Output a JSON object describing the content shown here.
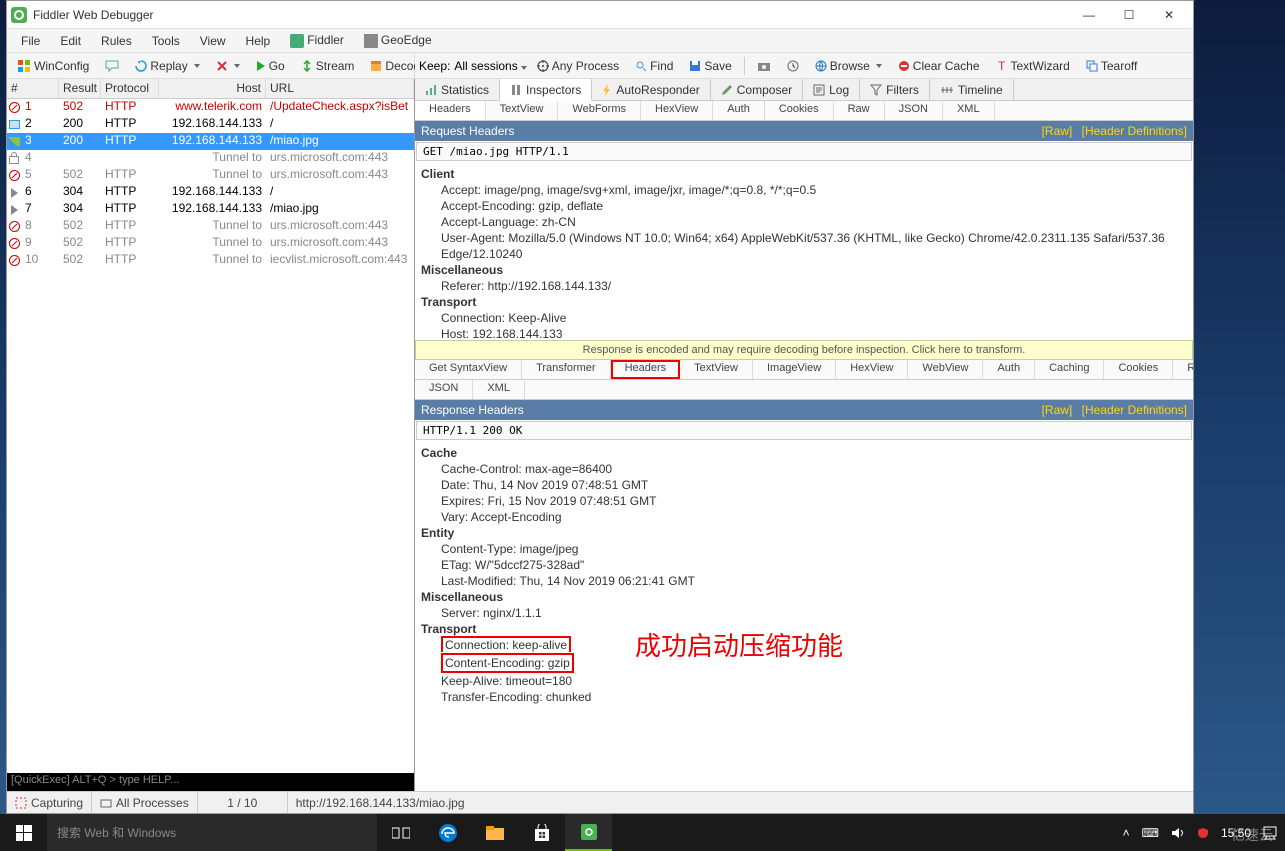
{
  "window_title": "Fiddler Web Debugger",
  "menus": [
    "File",
    "Edit",
    "Rules",
    "Tools",
    "View",
    "Help"
  ],
  "menu_extras": [
    {
      "label": "Fiddler",
      "icon": "fiddler"
    },
    {
      "label": "GeoEdge",
      "icon": "geo"
    }
  ],
  "toolbar": {
    "winconfig": "WinConfig",
    "replay": "Replay",
    "go": "Go",
    "stream": "Stream",
    "decode": "Decode"
  },
  "right_toolbar": {
    "keep_label": "Keep:",
    "keep_value": "All sessions",
    "any_process": "Any Process",
    "find": "Find",
    "save": "Save",
    "browse": "Browse",
    "clear_cache": "Clear Cache",
    "textwizard": "TextWizard",
    "tearoff": "Tearoff"
  },
  "session_cols": {
    "num": "#",
    "result": "Result",
    "protocol": "Protocol",
    "host": "Host",
    "url": "URL"
  },
  "sessions": [
    {
      "icon": "block",
      "num": "1",
      "result": "502",
      "proto": "HTTP",
      "host": "www.telerik.com",
      "url": "/UpdateCheck.aspx?isBet",
      "red": true
    },
    {
      "icon": "code",
      "num": "2",
      "result": "200",
      "proto": "HTTP",
      "host": "192.168.144.133",
      "url": "/"
    },
    {
      "icon": "img",
      "num": "3",
      "result": "200",
      "proto": "HTTP",
      "host": "192.168.144.133",
      "url": "/miao.jpg",
      "selected": true
    },
    {
      "icon": "lock",
      "num": "4",
      "result": "",
      "proto": "",
      "host": "Tunnel to",
      "url": "urs.microsoft.com:443",
      "gray": true
    },
    {
      "icon": "block",
      "num": "5",
      "result": "502",
      "proto": "HTTP",
      "host": "Tunnel to",
      "url": "urs.microsoft.com:443",
      "gray": true
    },
    {
      "icon": "arrow",
      "num": "6",
      "result": "304",
      "proto": "HTTP",
      "host": "192.168.144.133",
      "url": "/"
    },
    {
      "icon": "arrow",
      "num": "7",
      "result": "304",
      "proto": "HTTP",
      "host": "192.168.144.133",
      "url": "/miao.jpg"
    },
    {
      "icon": "block",
      "num": "8",
      "result": "502",
      "proto": "HTTP",
      "host": "Tunnel to",
      "url": "urs.microsoft.com:443",
      "gray": true
    },
    {
      "icon": "block",
      "num": "9",
      "result": "502",
      "proto": "HTTP",
      "host": "Tunnel to",
      "url": "urs.microsoft.com:443",
      "gray": true
    },
    {
      "icon": "block",
      "num": "10",
      "result": "502",
      "proto": "HTTP",
      "host": "Tunnel to",
      "url": "iecvlist.microsoft.com:443",
      "gray": true
    }
  ],
  "quickexec": "[QuickExec] ALT+Q > type HELP...",
  "main_tabs": [
    {
      "label": "Statistics",
      "icon": "chart"
    },
    {
      "label": "Inspectors",
      "icon": "inspect",
      "active": true
    },
    {
      "label": "AutoResponder",
      "icon": "bolt"
    },
    {
      "label": "Composer",
      "icon": "compose"
    },
    {
      "label": "Log",
      "icon": "log"
    },
    {
      "label": "Filters",
      "icon": "filter"
    },
    {
      "label": "Timeline",
      "icon": "timeline"
    }
  ],
  "req_tabs": [
    "Headers",
    "TextView",
    "WebForms",
    "HexView",
    "Auth",
    "Cookies",
    "Raw",
    "JSON",
    "XML"
  ],
  "req_section": {
    "title": "Request Headers",
    "raw": "[Raw]",
    "defs": "[Header Definitions]"
  },
  "req_line": "GET /miao.jpg HTTP/1.1",
  "req_headers": {
    "Client": [
      "Accept: image/png, image/svg+xml, image/jxr, image/*;q=0.8, */*;q=0.5",
      "Accept-Encoding: gzip, deflate",
      "Accept-Language: zh-CN",
      "User-Agent: Mozilla/5.0 (Windows NT 10.0; Win64; x64) AppleWebKit/537.36 (KHTML, like Gecko) Chrome/42.0.2311.135 Safari/537.36 Edge/12.10240"
    ],
    "Miscellaneous": [
      "Referer: http://192.168.144.133/"
    ],
    "Transport": [
      "Connection: Keep-Alive",
      "Host: 192.168.144.133"
    ]
  },
  "transform_msg": "Response is encoded and may require decoding before inspection. Click here to transform.",
  "resp_tabs_row1": [
    "Get SyntaxView",
    "Transformer",
    "Headers",
    "TextView",
    "ImageView",
    "HexView",
    "WebView",
    "Auth",
    "Caching",
    "Cookies",
    "Raw"
  ],
  "resp_tabs_row2": [
    "JSON",
    "XML"
  ],
  "resp_section": {
    "title": "Response Headers",
    "raw": "[Raw]",
    "defs": "[Header Definitions]"
  },
  "resp_line": "HTTP/1.1 200 OK",
  "resp_headers": {
    "Cache": [
      "Cache-Control: max-age=86400",
      "Date: Thu, 14 Nov 2019 07:48:51 GMT",
      "Expires: Fri, 15 Nov 2019 07:48:51 GMT",
      "Vary: Accept-Encoding"
    ],
    "Entity": [
      "Content-Type: image/jpeg",
      "ETag: W/\"5dccf275-328ad\"",
      "Last-Modified: Thu, 14 Nov 2019 06:21:41 GMT"
    ],
    "Miscellaneous": [
      "Server: nginx/1.1.1"
    ],
    "Transport": [
      "Connection: keep-alive",
      "Content-Encoding: gzip",
      "Keep-Alive: timeout=180",
      "Transfer-Encoding: chunked"
    ]
  },
  "annotation": "成功启动压缩功能",
  "statusbar": {
    "capturing": "Capturing",
    "processes": "All Processes",
    "count": "1 / 10",
    "url": "http://192.168.144.133/miao.jpg"
  },
  "taskbar": {
    "search_placeholder": "搜索 Web 和 Windows",
    "time": "15:50"
  }
}
